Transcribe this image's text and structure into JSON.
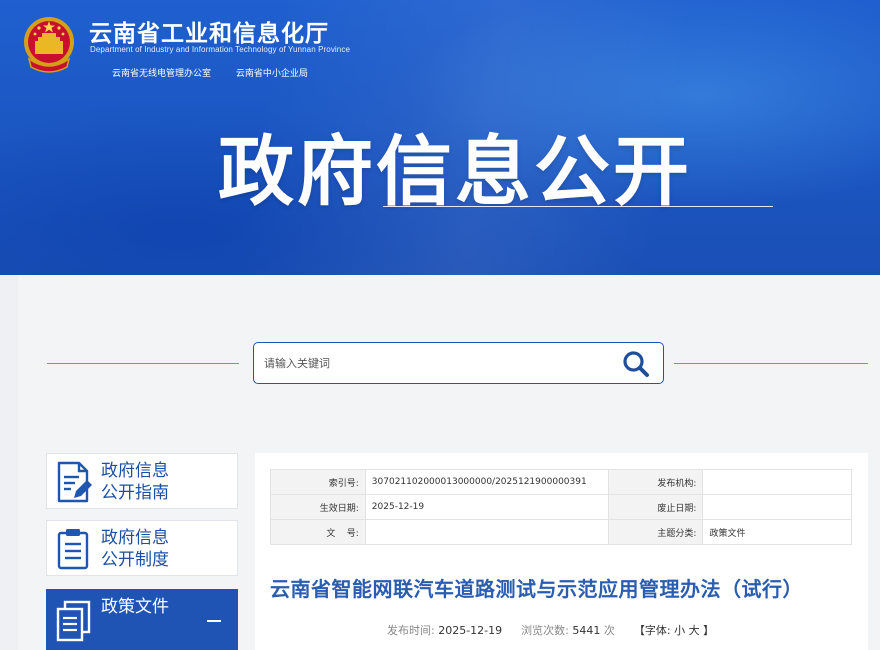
{
  "header": {
    "site_title": "云南省工业和信息化厅",
    "site_title_en": "Department of Industry and Information Technology of Yunnan Province",
    "sub_units": [
      "云南省无线电管理办公室",
      "云南省中小企业局"
    ],
    "banner_title": "政府信息公开"
  },
  "search": {
    "placeholder": "请输入关键词",
    "icon": "search-icon"
  },
  "sidebar": {
    "items": [
      {
        "label_line1": "政府信息",
        "label_line2": "公开指南",
        "icon": "document-edit-icon",
        "active": false
      },
      {
        "label_line1": "政府信息",
        "label_line2": "公开制度",
        "icon": "clipboard-list-icon",
        "active": false
      },
      {
        "label_line1": "政策文件",
        "label_line2": "",
        "icon": "documents-icon",
        "active": true,
        "expanded": true
      }
    ]
  },
  "meta": {
    "index_label": "索引号:",
    "index_value": "307021102000013000000/2025121900000391",
    "publisher_label": "发布机构:",
    "publisher_value": "",
    "effective_label": "生效日期:",
    "effective_value": "2025-12-19",
    "expire_label": "废止日期:",
    "expire_value": "",
    "docno_label": "文    号:",
    "docno_value": "",
    "topic_label": "主题分类:",
    "topic_value": "政策文件"
  },
  "article": {
    "title": "云南省智能网联汽车道路测试与示范应用管理办法（试行）",
    "publish_label": "发布时间:",
    "publish_date": "2025-12-19",
    "views_label": "浏览次数:",
    "views_count": "5441",
    "views_unit": "次",
    "font_label": "【字体:",
    "font_small": "小",
    "font_large": "大",
    "font_close": "】"
  },
  "colors": {
    "brand_blue": "#2054b4",
    "title_blue": "#2a5db0",
    "nav_text": "#1a4fa5"
  }
}
